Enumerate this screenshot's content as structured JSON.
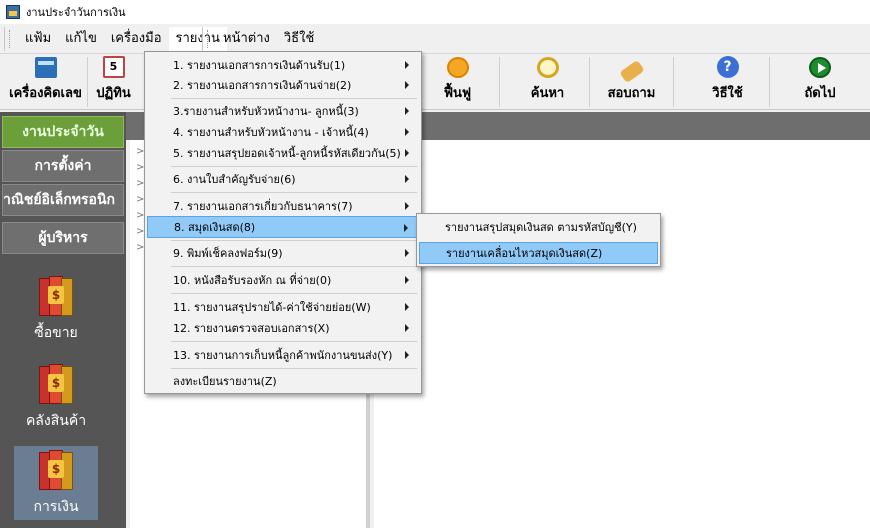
{
  "window": {
    "title": "งานประจำวันการเงิน"
  },
  "menubar": {
    "group1": [
      "แฟ้ม",
      "แก้ไข",
      "เครื่องมือ",
      "รายงาน"
    ],
    "group2": [
      "หน้าต่าง",
      "วิธีใช้"
    ]
  },
  "toolbar": {
    "buttons": [
      {
        "label": "เครื่องคิดเลข",
        "icon": "calculator-icon"
      },
      {
        "label": "ปฏิทิน",
        "icon": "calendar-icon"
      },
      {
        "label": "ฟื้นฟู",
        "icon": "refresh-icon"
      },
      {
        "label": "ค้นหา",
        "icon": "search-icon"
      },
      {
        "label": "สอบถาม",
        "icon": "phone-icon"
      },
      {
        "label": "วิธีใช้",
        "icon": "help-icon"
      },
      {
        "label": "ถัดไป",
        "icon": "next-icon"
      }
    ],
    "calendar_digit": "5"
  },
  "leftnav": {
    "buttons": [
      "งานประจำวัน",
      "การตั้งค่า",
      "าณิชย์อิเล็กทรอนิก",
      "ผู้บริหาร"
    ],
    "tiles": [
      "ซื้อขาย",
      "คลังสินค้า",
      "การเงิน"
    ],
    "tile_badge": "$"
  },
  "tree": {
    "arrow": ">"
  },
  "report_menu": {
    "items": [
      "1. รายงานเอกสารการเงินด้านรับ(1)",
      "2. รายงานเอกสารการเงินด้านจ่าย(2)",
      "3.รายงานสำหรับหัวหน้างาน- ลูกหนี้(3)",
      "4. รายงานสำหรับหัวหน้างาน - เจ้าหนี้(4)",
      "5. รายงานสรุปยอดเจ้าหนี้-ลูกหนี้รหัสเดียวกัน(5)",
      "6. งานใบสำคัญรับจ่าย(6)",
      "7. รายงานเอกสารเกี่ยวกับธนาคาร(7)",
      "8. สมุดเงินสด(8)",
      "9. พิมพ์เช็คลงฟอร์ม(9)",
      "10. หนังสือรับรองหัก ณ ที่จ่าย(0)",
      "11. รายงานสรุปรายได้-ค่าใช้จ่ายย่อย(W)",
      "12. รายงานตรวจสอบเอกสาร(X)",
      "13. รายงานการเก็บหนี้ลูกค้าพนักงานขนส่ง(Y)",
      "ลงทะเบียนรายงาน(Z)"
    ],
    "highlighted": "8. สมุดเงินสด(8)"
  },
  "cash_book_submenu": {
    "items": [
      "รายงานสรุปสมุดเงินสด ตามรหัสบัญชี(Y)",
      "รายงานเคลื่อนไหวสมุดเงินสด(Z)"
    ],
    "highlighted": "รายงานเคลื่อนไหวสมุดเงินสด(Z)"
  },
  "colors": {
    "nav_background": "#555555",
    "active_nav": "#6c9e3a",
    "menu_highlight": "#91c9f7"
  }
}
